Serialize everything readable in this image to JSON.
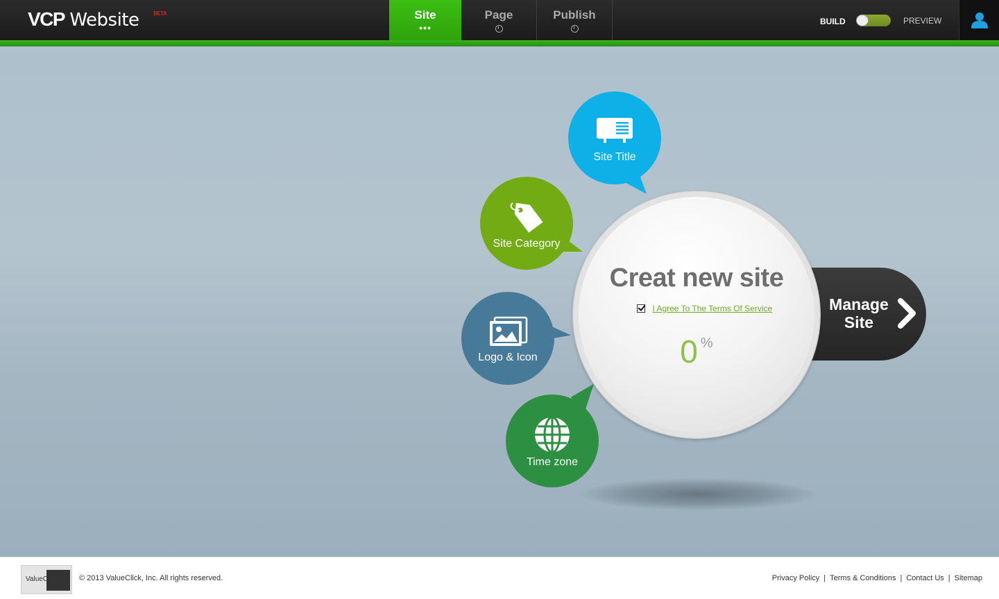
{
  "header": {
    "logo_main": "VCP",
    "logo_sub": "Website",
    "logo_badge": "BETA",
    "tabs": [
      {
        "label": "Site",
        "active": true
      },
      {
        "label": "Page",
        "active": false
      },
      {
        "label": "Publish",
        "active": false
      }
    ],
    "mode_build": "BUILD",
    "mode_preview": "PREVIEW"
  },
  "main": {
    "title": "Creat new site",
    "agree_text": "I Agree To The Terms Of Service",
    "progress_value": "0",
    "progress_unit": "%",
    "manage_label": "Manage Site",
    "bubbles": [
      {
        "label": "Site Title",
        "color": "#0eb0e8",
        "icon": "presentation-icon"
      },
      {
        "label": "Site Category",
        "color": "#72ab14",
        "icon": "tag-icon"
      },
      {
        "label": "Logo & Icon",
        "color": "#467a98",
        "icon": "image-icon"
      },
      {
        "label": "Time zone",
        "color": "#2d8f42",
        "icon": "globe-icon"
      }
    ]
  },
  "footer": {
    "logo_text": "ValueClick",
    "copyright": "© 2013 ValueClick, Inc. All rights reserved.",
    "links": [
      "Privacy Policy",
      "Terms & Conditions",
      "Contact Us",
      "Sitemap"
    ]
  },
  "colors": {
    "accent_green": "#37b51a",
    "topbar": "#1f1f1f",
    "background": "#b2c3cf"
  }
}
